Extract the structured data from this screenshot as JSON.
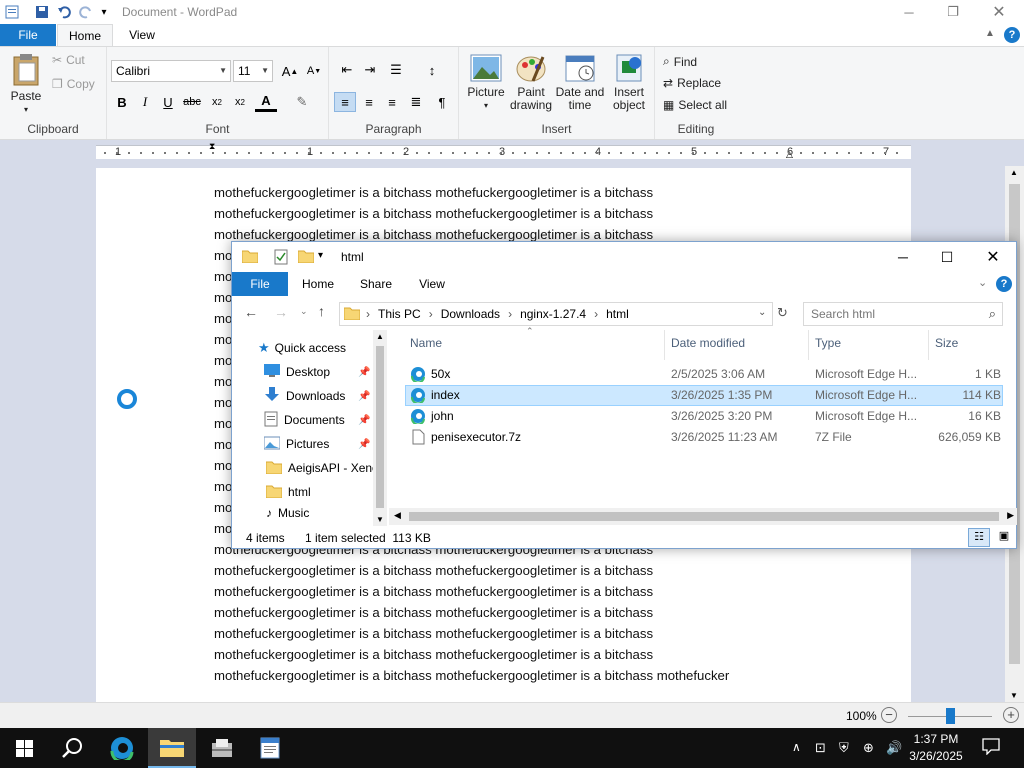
{
  "wordpad": {
    "title": "Document - WordPad",
    "tabs": {
      "file": "File",
      "home": "Home",
      "view": "View"
    },
    "clipboard": {
      "paste": "Paste",
      "cut": "Cut",
      "copy": "Copy",
      "group": "Clipboard"
    },
    "font": {
      "name": "Calibri",
      "size": "11",
      "group": "Font"
    },
    "paragraph": {
      "group": "Paragraph"
    },
    "insert": {
      "picture": "Picture",
      "paint_drawing": "Paint drawing",
      "date_time": "Date and time",
      "insert_object": "Insert object",
      "group": "Insert"
    },
    "editing": {
      "find": "Find",
      "replace": "Replace",
      "select_all": "Select all",
      "group": "Editing"
    },
    "ruler_numbers": [
      "1",
      "1",
      "2",
      "3",
      "4",
      "5",
      "6",
      "7"
    ],
    "document_lines": [
      "mothefuckergoogletimer is a bitchass mothefuckergoogletimer is a bitchass",
      "mothefuckergoogletimer is a bitchass mothefuckergoogletimer is a bitchass",
      "mothefuckergoogletimer is a bitchass mothefuckergoogletimer is a bitchass",
      "mothefuckergoogletimer is a bitchass mothefuckergoogletimer is a bitchass",
      "mothefuckergoogletimer is a bitchass mothefuckergoogletimer is a bitchass",
      "mothefuckergoogletimer is a bitchass mothefuckergoogletimer is a bitchass",
      "mothefuckergoogletimer is a bitchass mothefuckergoogletimer is a bitchass",
      "mothefuckergoogletimer is a bitchass mothefuckergoogletimer is a bitchass",
      "mothefuckergoogletimer is a bitchass mothefuckergoogletimer is a bitchass",
      "mothefuckergoogletimer is a bitchass mothefuckergoogletimer is a bitchass",
      "mothefuckergoogletimer is a bitchass mothefuckergoogletimer is a bitchass",
      "mothefuckergoogletimer is a bitchass mothefuckergoogletimer is a bitchass",
      "mothefuckergoogletimer is a bitchass mothefuckergoogletimer is a bitchass",
      "mothefuckergoogletimer is a bitchass mothefuckergoogletimer is a bitchass",
      "mothefuckergoogletimer is a bitchass mothefuckergoogletimer is a bitchass",
      "mothefuckergoogletimer is a bitchass mothefuckergoogletimer is a bitchass",
      "mothefuckergoogletimer is a bitchass mothefuckergoogletimer is a bitchass",
      "mothefuckergoogletimer is a bitchass mothefuckergoogletimer is a bitchass",
      "mothefuckergoogletimer is a bitchass mothefuckergoogletimer is a bitchass",
      "mothefuckergoogletimer is a bitchass mothefuckergoogletimer is a bitchass",
      "mothefuckergoogletimer is a bitchass mothefuckergoogletimer is a bitchass",
      "mothefuckergoogletimer is a bitchass mothefuckergoogletimer is a bitchass",
      "mothefuckergoogletimer is a bitchass mothefuckergoogletimer is a bitchass",
      "mothefuckergoogletimer is a bitchass mothefuckergoogletimer is a bitchass mothefucker"
    ],
    "zoom": "100%"
  },
  "explorer": {
    "title": "html",
    "tabs": {
      "file": "File",
      "home": "Home",
      "share": "Share",
      "view": "View"
    },
    "breadcrumb": [
      "This PC",
      "Downloads",
      "nginx-1.27.4",
      "html"
    ],
    "search_placeholder": "Search html",
    "nav": [
      {
        "label": "Quick access"
      },
      {
        "label": "Desktop"
      },
      {
        "label": "Downloads"
      },
      {
        "label": "Documents"
      },
      {
        "label": "Pictures"
      },
      {
        "label": "AeigisAPI - Xenc"
      },
      {
        "label": "html"
      },
      {
        "label": "Music"
      }
    ],
    "columns": {
      "name": "Name",
      "date": "Date modified",
      "type": "Type",
      "size": "Size"
    },
    "files": [
      {
        "name": "50x",
        "date": "2/5/2025 3:06 AM",
        "type": "Microsoft Edge H...",
        "size": "1 KB"
      },
      {
        "name": "index",
        "date": "3/26/2025 1:35 PM",
        "type": "Microsoft Edge H...",
        "size": "114 KB"
      },
      {
        "name": "john",
        "date": "3/26/2025 3:20 PM",
        "type": "Microsoft Edge H...",
        "size": "16 KB"
      },
      {
        "name": "penisexecutor.7z",
        "date": "3/26/2025 11:23 AM",
        "type": "7Z File",
        "size": "626,059 KB"
      }
    ],
    "status": {
      "count": "4 items",
      "selected": "1 item selected  113 KB"
    }
  },
  "taskbar": {
    "time": "1:37 PM",
    "date": "3/26/2025"
  },
  "colors": {
    "accent": "#1979ca",
    "selection": "#cce8ff",
    "taskbar": "#101010"
  }
}
